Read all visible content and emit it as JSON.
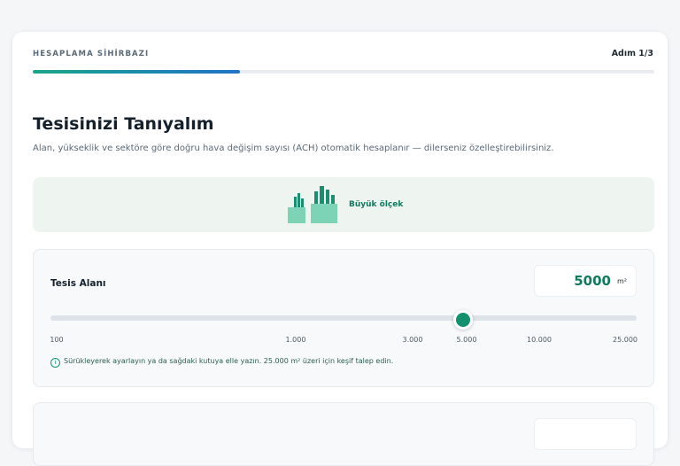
{
  "header": {
    "wizard_label": "HESAPLAMA SİHİRBAZI",
    "step_label": "Adım 1/3",
    "progress_fraction": 0.333
  },
  "main": {
    "title": "Tesisinizi Tanıyalım",
    "subtitle": "Alan, yükseklik ve sektöre göre doğru hava değişim sayısı (ACH) otomatik hesaplanır — dilerseniz özelleştirebilirsiniz."
  },
  "scale": {
    "label": "Büyük ölçek",
    "icon": "buildings-icon",
    "accent": "#1aa68a"
  },
  "area": {
    "label": "Tesis Alanı",
    "value": "5000",
    "unit": "m²",
    "slider_value": 5000,
    "ticks": [
      "100",
      "1.000",
      "3.000",
      "5.000",
      "10.000",
      "25.000"
    ],
    "hint": "Sürükleyerek ayarlayın ya da sağdaki kutuya elle yazın. 25.000 m² üzeri için keşif talep edin.",
    "hint_icon": "info-icon"
  },
  "colors": {
    "accent": "#13906e",
    "progress_start": "#1aa68a",
    "progress_end": "#1f73c9"
  }
}
